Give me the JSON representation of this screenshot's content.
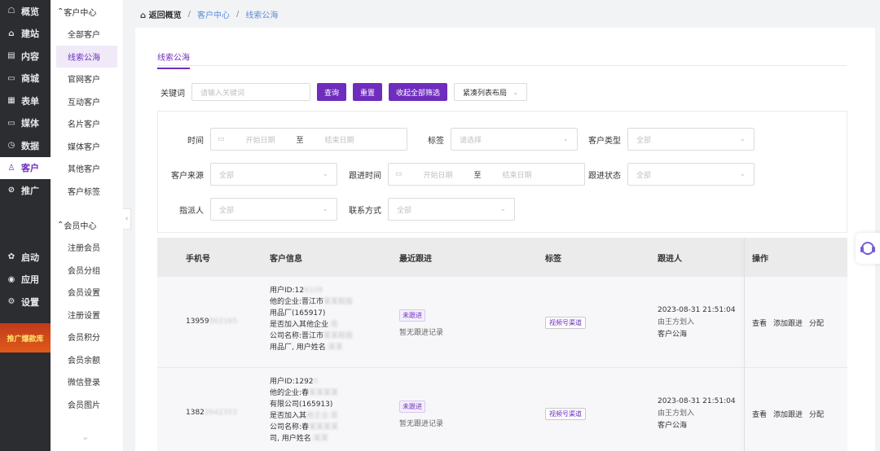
{
  "nav_primary": [
    {
      "icon": "☖",
      "label": "概览"
    },
    {
      "icon": "⌂",
      "label": "建站"
    },
    {
      "icon": "▤",
      "label": "内容"
    },
    {
      "icon": "▭",
      "label": "商城"
    },
    {
      "icon": "▦",
      "label": "表单"
    },
    {
      "icon": "▭",
      "label": "媒体"
    },
    {
      "icon": "◷",
      "label": "数据"
    },
    {
      "icon": "♙",
      "label": "客户"
    },
    {
      "icon": "⊘",
      "label": "推广"
    }
  ],
  "nav_bottom": [
    {
      "icon": "✿",
      "label": "启动"
    },
    {
      "icon": "◉",
      "label": "应用"
    },
    {
      "icon": "⚙",
      "label": "设置"
    }
  ],
  "promo": "推广爆款库",
  "sub_groups": {
    "customer": "客户中心",
    "member": "会员中心"
  },
  "sub_customer": [
    "全部客户",
    "线索公海",
    "官网客户",
    "互动客户",
    "名片客户",
    "媒体客户",
    "其他客户",
    "客户标签"
  ],
  "sub_member": [
    "注册会员",
    "会员分组",
    "会员设置",
    "注册设置",
    "会员积分",
    "会员余额",
    "微信登录",
    "会员图片"
  ],
  "breadcrumb": {
    "back": "返回概览",
    "sep": "/",
    "level1": "客户中心",
    "current": "线索公海"
  },
  "tab": "线索公海",
  "search": {
    "label": "关键词",
    "placeholder": "请输入关键词",
    "query": "查询",
    "reset": "重置",
    "collapse": "收起全部筛选",
    "layout": "紧凑列表布局"
  },
  "filters": {
    "time": "时间",
    "start": "开始日期",
    "to": "至",
    "end": "结束日期",
    "tag": "标签",
    "tag_ph": "请选择",
    "ctype": "客户类型",
    "all": "全部",
    "source": "客户来源",
    "follow_time": "跟进时间",
    "follow_status": "跟进状态",
    "assignee": "指派人",
    "contact": "联系方式"
  },
  "table": {
    "headers": [
      "手机号",
      "客户信息",
      "最近跟进",
      "标签",
      "跟进人",
      "操作"
    ],
    "rows": [
      {
        "phone": "13959",
        "phone_masked": "862165",
        "info": [
          {
            "t": "用户ID:12",
            "m": "8109"
          },
          {
            "t": "他的企业:晋江市",
            "m": "某某鞋服"
          },
          {
            "t": "用品厂(165917)",
            "m": ""
          },
          {
            "t": "是否加入其他企业",
            "m": ":是"
          },
          {
            "t": "公司名称:晋江市",
            "m": "某某鞋服"
          },
          {
            "t": "用品厂, 用户姓名",
            "m": ":某某"
          }
        ],
        "status": "未跟进",
        "record": "暂无跟进记录",
        "tag": "视频号渠道",
        "datetime": "2023-08-31 21:51:04",
        "assign": "由王方划入",
        "pool": "客户公海",
        "ops": [
          "查看",
          "添加跟进",
          "分配"
        ]
      },
      {
        "phone": "1382",
        "phone_masked": "2642353",
        "info": [
          {
            "t": "用户ID:1292",
            "m": "0"
          },
          {
            "t": "他的企业:春",
            "m": "某某某某"
          },
          {
            "t": "有限公司(165913)",
            "m": ""
          },
          {
            "t": "是否加入其",
            "m": "他企业:是"
          },
          {
            "t": "公司名称:春",
            "m": "某某某某"
          },
          {
            "t": "司, 用户姓名",
            "m": ":某某"
          }
        ],
        "status": "未跟进",
        "record": "暂无跟进记录",
        "tag": "视频号渠道",
        "datetime": "2023-08-31 21:51:04",
        "assign": "由王方划入",
        "pool": "客户公海",
        "ops": [
          "查看",
          "添加跟进",
          "分配"
        ]
      }
    ]
  },
  "colors": {
    "accent": "#6e2dbd",
    "sidebar": "#2b2d31",
    "link": "#5b8bd9"
  }
}
